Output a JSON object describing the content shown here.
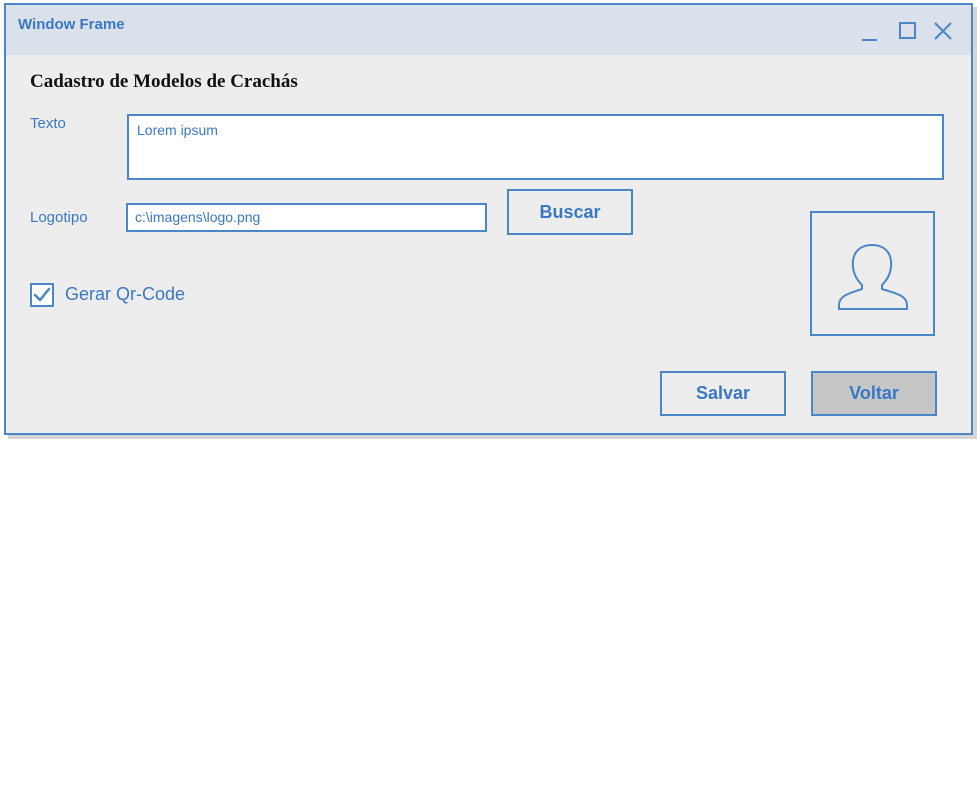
{
  "window": {
    "title": "Window Frame",
    "controls": [
      "minimize-icon",
      "maximize-icon",
      "close-icon"
    ]
  },
  "form": {
    "title": "Cadastro de Modelos de Crachás",
    "texto": {
      "label": "Texto",
      "value": "Lorem ipsum"
    },
    "logotipo": {
      "label": "Logotipo",
      "value": "c:\\imagens\\logo.png",
      "button_label": "Buscar"
    },
    "qrcode": {
      "label": "Gerar Qr-Code",
      "checked": true
    },
    "preview_icon": "user-icon",
    "actions": {
      "save_label": "Salvar",
      "back_label": "Voltar"
    }
  },
  "colors": {
    "accent": "#4a86c8",
    "text_accent": "#3a78c3",
    "titlebar_bg": "#dae1ea",
    "window_bg": "#ededed",
    "disabled_button_bg": "#c6c6c6"
  }
}
